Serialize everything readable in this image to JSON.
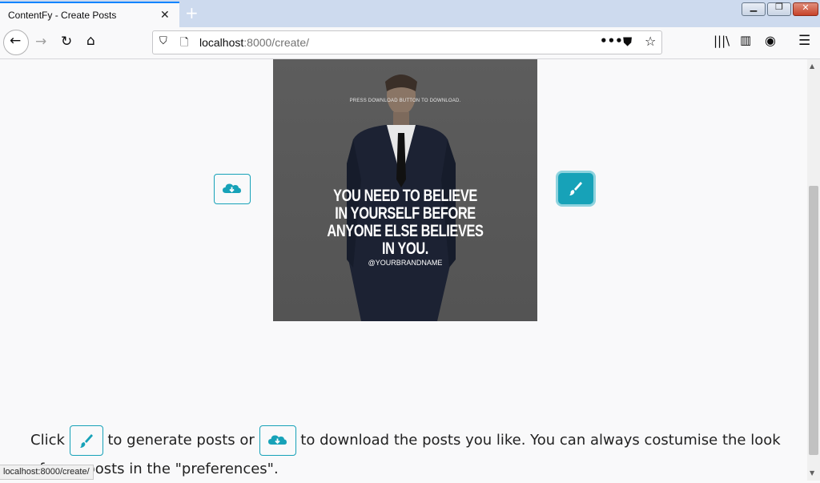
{
  "browser": {
    "tab_title": "ContentFy - Create Posts",
    "url_host": "localhost",
    "url_rest": ":8000/create/",
    "status_url": "localhost:8000/create/"
  },
  "post": {
    "press_text": "PRESS DOWNLOAD BUTTON TO DOWNLOAD.",
    "quote_lines": [
      "YOU NEED TO BELIEVE",
      "IN YOURSELF BEFORE",
      "ANYONE ELSE BELIEVES",
      "IN YOU."
    ],
    "handle": "@YOURBRANDNAME"
  },
  "instructions": {
    "part1": "Click",
    "part2": "to generate posts or",
    "part3": "to download the posts you like. You can always costumise the look of your posts in the \"preferences\"."
  },
  "colors": {
    "accent": "#17a2b8",
    "tab_highlight": "#0a84ff"
  }
}
